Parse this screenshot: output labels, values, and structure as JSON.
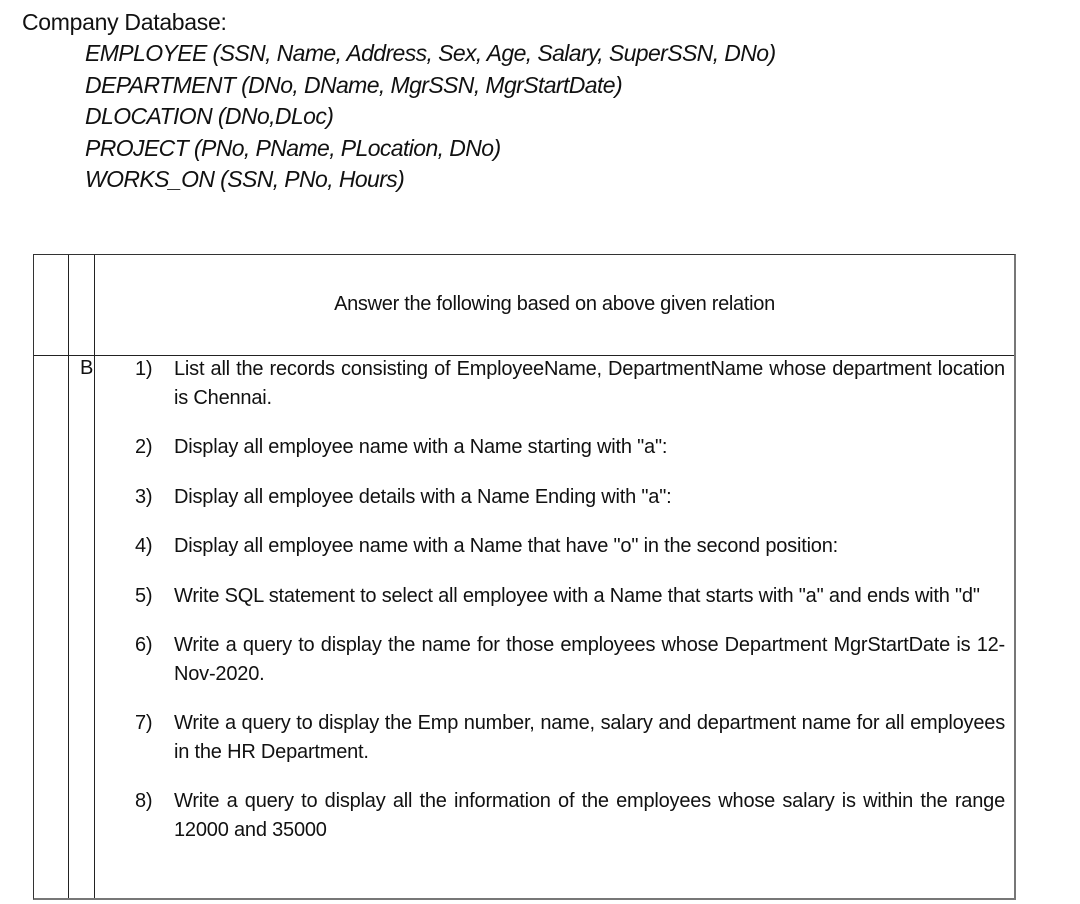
{
  "document": {
    "title": "Company Database:",
    "schema": [
      "EMPLOYEE (SSN, Name, Address, Sex, Age, Salary, SuperSSN, DNo)",
      "DEPARTMENT (DNo, DName, MgrSSN, MgrStartDate)",
      "DLOCATION (DNo,DLoc)",
      "PROJECT (PNo, PName, PLocation, DNo)",
      "WORKS_ON (SSN, PNo, Hours)"
    ],
    "table": {
      "header": "Answer the following based on above given relation",
      "section_label": "B",
      "questions": [
        {
          "num": "1)",
          "text": "List all the records consisting of EmployeeName, DepartmentName whose department location is Chennai."
        },
        {
          "num": "2)",
          "text": "Display all employee name with a Name starting with \"a\":"
        },
        {
          "num": "3)",
          "text": "Display all employee details with a Name Ending with \"a\":"
        },
        {
          "num": "4)",
          "text": "Display all employee name with a Name that have \"o\" in the second position:"
        },
        {
          "num": "5)",
          "text": "Write SQL statement to select all employee with a Name that starts with \"a\" and ends with \"d\""
        },
        {
          "num": "6)",
          "text": "Write a query to display the name for those employees whose Department MgrStartDate is 12-Nov-2020."
        },
        {
          "num": "7)",
          "text": "Write a query to display the Emp number, name, salary and department name for all employees in the HR Department."
        },
        {
          "num": "8)",
          "text": "Write a query to display all the information of the employees whose salary is within the range 12000 and 35000"
        }
      ]
    }
  }
}
